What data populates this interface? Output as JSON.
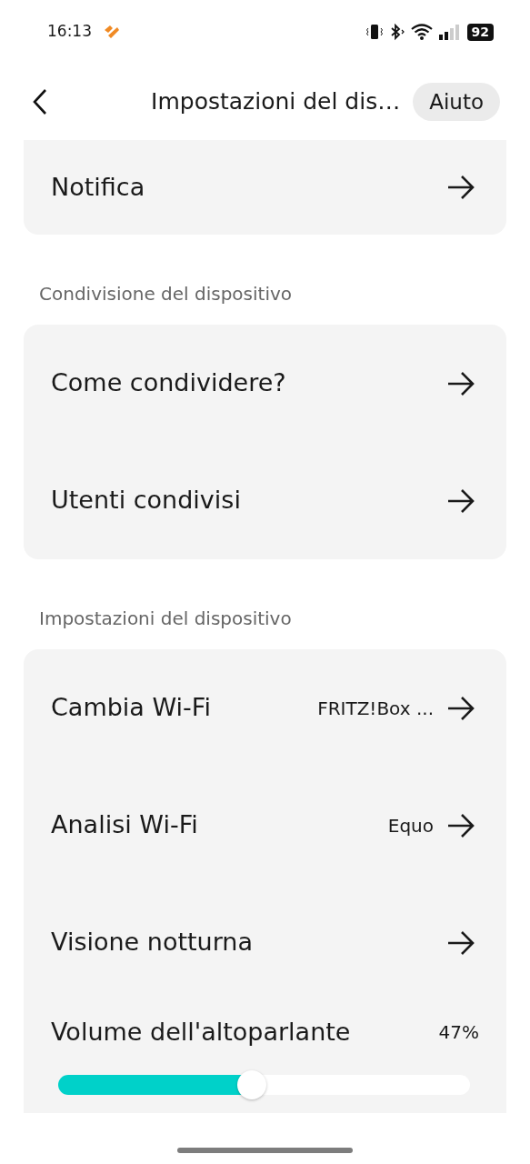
{
  "status_bar": {
    "time": "16:13",
    "battery": "92"
  },
  "header": {
    "title": "Impostazioni del dis…",
    "help_button": "Aiuto"
  },
  "sections": [
    {
      "items": [
        {
          "kind": "link",
          "label": "Notifica"
        }
      ]
    },
    {
      "title": "Condivisione del dispositivo",
      "items": [
        {
          "kind": "link",
          "label": "Come condividere?"
        },
        {
          "kind": "link",
          "label": "Utenti condivisi"
        }
      ]
    },
    {
      "title": "Impostazioni del dispositivo",
      "items": [
        {
          "kind": "link",
          "label": "Cambia Wi-Fi",
          "value": "FRITZ!Box ..."
        },
        {
          "kind": "link",
          "label": "Analisi Wi-Fi",
          "value": "Equo"
        },
        {
          "kind": "link",
          "label": "Visione notturna"
        },
        {
          "kind": "slider",
          "label": "Volume dell'altoparlante",
          "reading": "47%",
          "level": 0.47
        }
      ]
    }
  ]
}
